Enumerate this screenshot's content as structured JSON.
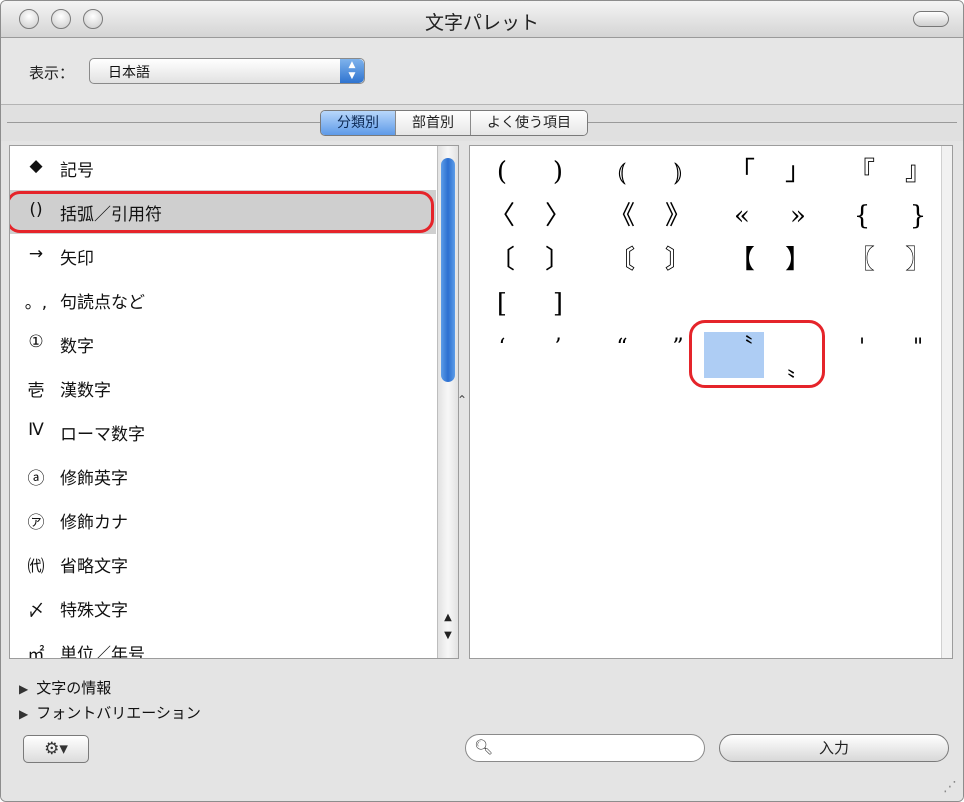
{
  "window": {
    "title": "文字パレット"
  },
  "toolbar": {
    "show_label": "表示：",
    "view_value": "日本語"
  },
  "tabs": [
    "分類別",
    "部首別",
    "よく使う項目"
  ],
  "categories": [
    {
      "glyph": "◆",
      "label": "記号"
    },
    {
      "glyph": "()",
      "label": "括弧／引用符"
    },
    {
      "glyph": "→",
      "label": "矢印"
    },
    {
      "glyph": "。,",
      "label": "句読点など"
    },
    {
      "glyph": "①",
      "label": "数字"
    },
    {
      "glyph": "壱",
      "label": "漢数字"
    },
    {
      "glyph": "Ⅳ",
      "label": "ローマ数字"
    },
    {
      "glyph": "ⓐ",
      "label": "修飾英字"
    },
    {
      "glyph": "㋐",
      "label": "修飾カナ"
    },
    {
      "glyph": "㈹",
      "label": "省略文字"
    },
    {
      "glyph": "〆",
      "label": "特殊文字"
    },
    {
      "glyph": "㎡",
      "label": "単位／年号"
    }
  ],
  "characters": [
    [
      "(",
      ")",
      "⦅",
      "⦆",
      "「",
      "」",
      "『",
      "』"
    ],
    [
      "〈",
      "〉",
      "《",
      "》",
      "«",
      "»",
      "{",
      "}"
    ],
    [
      "〔",
      "〕",
      "〘",
      "〙",
      "【",
      "】",
      "〖",
      "〗"
    ],
    [
      "[",
      "]"
    ],
    [
      "‘",
      "’",
      "“",
      "”",
      "〝",
      "〟",
      "'",
      "\""
    ]
  ],
  "bottom": {
    "char_info": "文字の情報",
    "font_variation": "フォントバリエーション",
    "enter_label": "入力",
    "search_value": ""
  },
  "icons": {
    "close": "circle",
    "minimize": "circle",
    "zoom": "circle",
    "toolbar_toggle": "pill",
    "popup_arrows": "▲▼",
    "gear": "⚙▾",
    "search": "magnifier",
    "disclosure": "▶",
    "resize": "grip"
  },
  "colors": {
    "selection": "#aecdf4",
    "annotation": "#e5242a",
    "accent": "#3b7fd8"
  }
}
